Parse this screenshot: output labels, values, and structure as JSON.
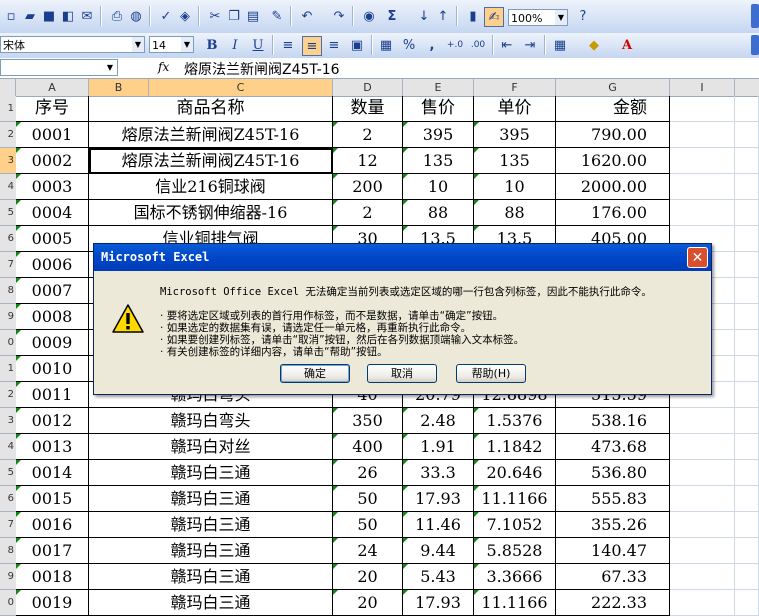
{
  "toolbar": {
    "zoom": "100%",
    "font_name": "宋体",
    "font_size": "14"
  },
  "formula_bar": {
    "name_box": "",
    "fx": "fx",
    "content": "熔原法兰新闸阀Z45T-16"
  },
  "columns": [
    "A",
    "B",
    "C",
    "D",
    "E",
    "F",
    "G",
    "I"
  ],
  "rows": [
    {
      "n": "1",
      "a": "序号",
      "c": "商品名称",
      "d": "数量",
      "e": "售价",
      "f": "单价",
      "g": "金额"
    },
    {
      "n": "2",
      "a": "0001",
      "c": "熔原法兰新闸阀Z45T-16",
      "d": "2",
      "e": "395",
      "f": "395",
      "g": "790.00"
    },
    {
      "n": "3",
      "a": "0002",
      "c": "熔原法兰新闸阀Z45T-16",
      "d": "12",
      "e": "135",
      "f": "135",
      "g": "1620.00"
    },
    {
      "n": "4",
      "a": "0003",
      "c": "信业216铜球阀",
      "d": "200",
      "e": "10",
      "f": "10",
      "g": "2000.00"
    },
    {
      "n": "5",
      "a": "0004",
      "c": "国标不锈钢伸缩器-16",
      "d": "2",
      "e": "88",
      "f": "88",
      "g": "176.00"
    },
    {
      "n": "6",
      "a": "0005",
      "c": "信业铜排气阀",
      "d": "30",
      "e": "13.5",
      "f": "13.5",
      "g": "405.00"
    },
    {
      "n": "7",
      "a": "0006",
      "c": "",
      "d": "",
      "e": "",
      "f": "",
      "g": ""
    },
    {
      "n": "8",
      "a": "0007",
      "c": "",
      "d": "",
      "e": "",
      "f": "",
      "g": ""
    },
    {
      "n": "9",
      "a": "0008",
      "c": "",
      "d": "",
      "e": "",
      "f": "",
      "g": ""
    },
    {
      "n": "0",
      "a": "0009",
      "c": "",
      "d": "",
      "e": "",
      "f": "",
      "g": ""
    },
    {
      "n": "1",
      "a": "0010",
      "c": "",
      "d": "",
      "e": "",
      "f": "",
      "g": ""
    },
    {
      "n": "2",
      "a": "0011",
      "c": "赣玛白弯头",
      "d": "40",
      "e": "20.79",
      "f": "12.8898",
      "g": "515.59"
    },
    {
      "n": "3",
      "a": "0012",
      "c": "赣玛白弯头",
      "d": "350",
      "e": "2.48",
      "f": "1.5376",
      "g": "538.16"
    },
    {
      "n": "4",
      "a": "0013",
      "c": "赣玛白对丝",
      "d": "400",
      "e": "1.91",
      "f": "1.1842",
      "g": "473.68"
    },
    {
      "n": "5",
      "a": "0014",
      "c": "赣玛白三通",
      "d": "26",
      "e": "33.3",
      "f": "20.646",
      "g": "536.80"
    },
    {
      "n": "6",
      "a": "0015",
      "c": "赣玛白三通",
      "d": "50",
      "e": "17.93",
      "f": "11.1166",
      "g": "555.83"
    },
    {
      "n": "7",
      "a": "0016",
      "c": "赣玛白三通",
      "d": "50",
      "e": "11.46",
      "f": "7.1052",
      "g": "355.26"
    },
    {
      "n": "8",
      "a": "0017",
      "c": "赣玛白三通",
      "d": "24",
      "e": "9.44",
      "f": "5.8528",
      "g": "140.47"
    },
    {
      "n": "9",
      "a": "0018",
      "c": "赣玛白三通",
      "d": "20",
      "e": "5.43",
      "f": "3.3666",
      "g": "67.33"
    },
    {
      "n": "0",
      "a": "0019",
      "c": "赣玛白三通",
      "d": "20",
      "e": "17.93",
      "f": "11.1166",
      "g": "222.33"
    }
  ],
  "dialog": {
    "title": "Microsoft Excel",
    "close": "✕",
    "message": "Microsoft Office Excel 无法确定当前列表或选定区域的哪一行包含列标签，因此不能执行此命令。",
    "bullets": [
      "要将选定区域或列表的首行用作标签，而不是数据，请单击“确定”按钮。",
      "如果选定的数据集有误，请选定任一单元格，再重新执行此命令。",
      "如果要创建列标签，请单击“取消”按钮，然后在各列数据顶端输入文本标签。",
      "有关创建标签的详细内容，请单击“帮助”按钮。"
    ],
    "ok": "确定",
    "cancel": "取消",
    "help": "帮助(H)"
  }
}
